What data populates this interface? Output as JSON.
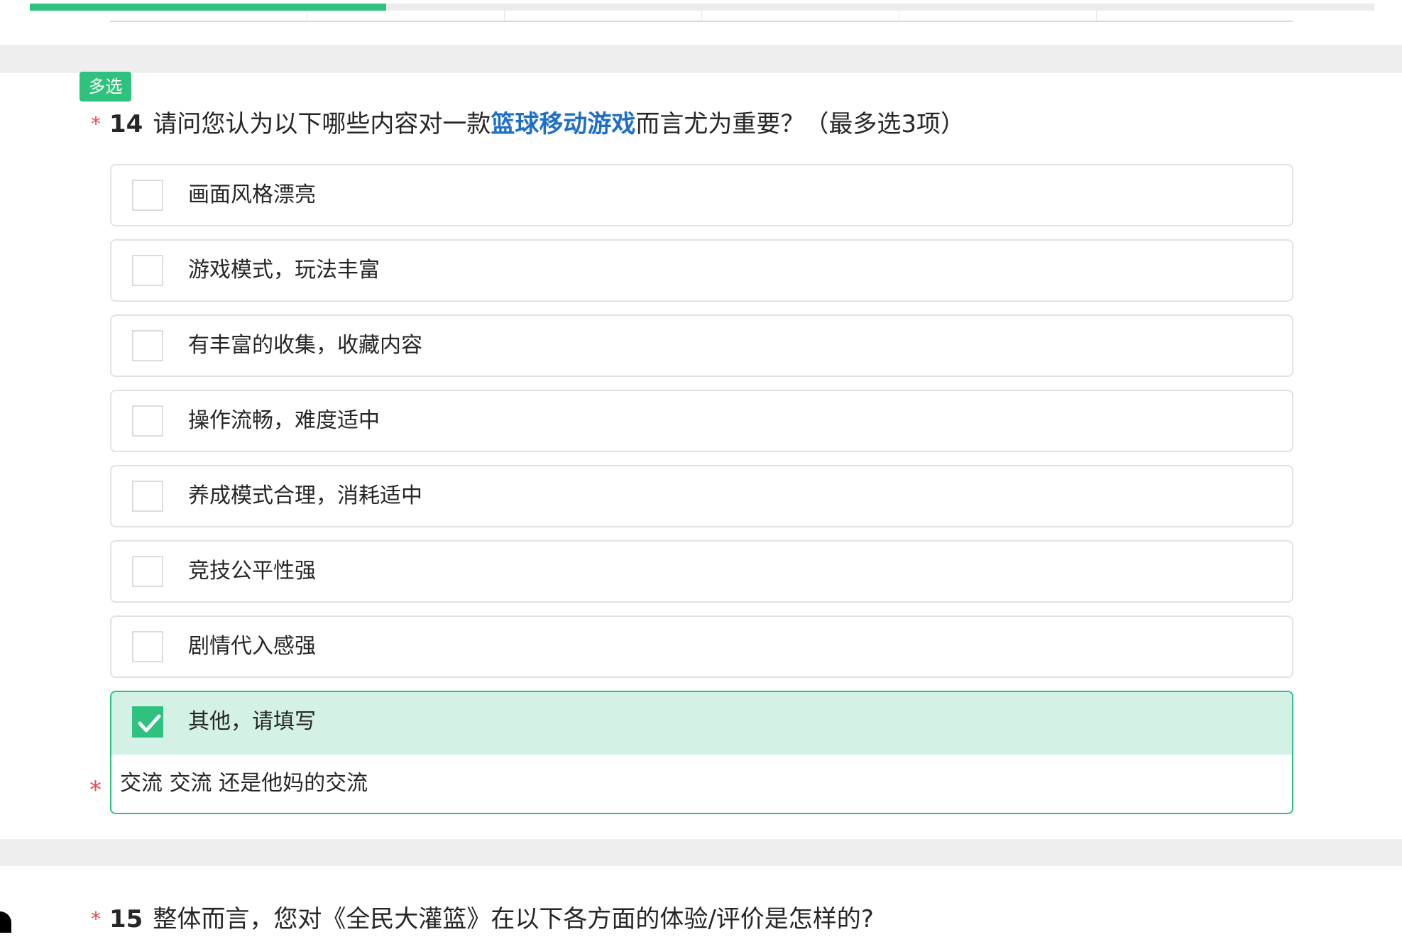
{
  "progress": {
    "percent": 26.5
  },
  "q14": {
    "type_badge": "多选",
    "required_mark": "*",
    "number": "14",
    "title_before": "请问您认为以下哪些内容对一款",
    "title_highlight": "篮球移动游戏",
    "title_after": "而言尤为重要？（最多选3项）",
    "options": [
      {
        "label": "画面风格漂亮",
        "checked": false
      },
      {
        "label": "游戏模式，玩法丰富",
        "checked": false
      },
      {
        "label": "有丰富的收集，收藏内容",
        "checked": false
      },
      {
        "label": "操作流畅，难度适中",
        "checked": false
      },
      {
        "label": "养成模式合理，消耗适中",
        "checked": false
      },
      {
        "label": "竞技公平性强",
        "checked": false
      },
      {
        "label": "剧情代入感强",
        "checked": false
      },
      {
        "label": "其他，请填写",
        "checked": true
      }
    ],
    "other_required_mark": "*",
    "other_value": "交流 交流 还是他妈的交流"
  },
  "q15": {
    "required_mark": "*",
    "number": "15",
    "title": "整体而言，您对《全民大灌篮》在以下各方面的体验/评价是怎样的?"
  },
  "colors": {
    "accent": "#2ec27e",
    "highlight": "#1e6fc8",
    "required": "#e5484d",
    "selected_bg": "#d3f2e5"
  }
}
